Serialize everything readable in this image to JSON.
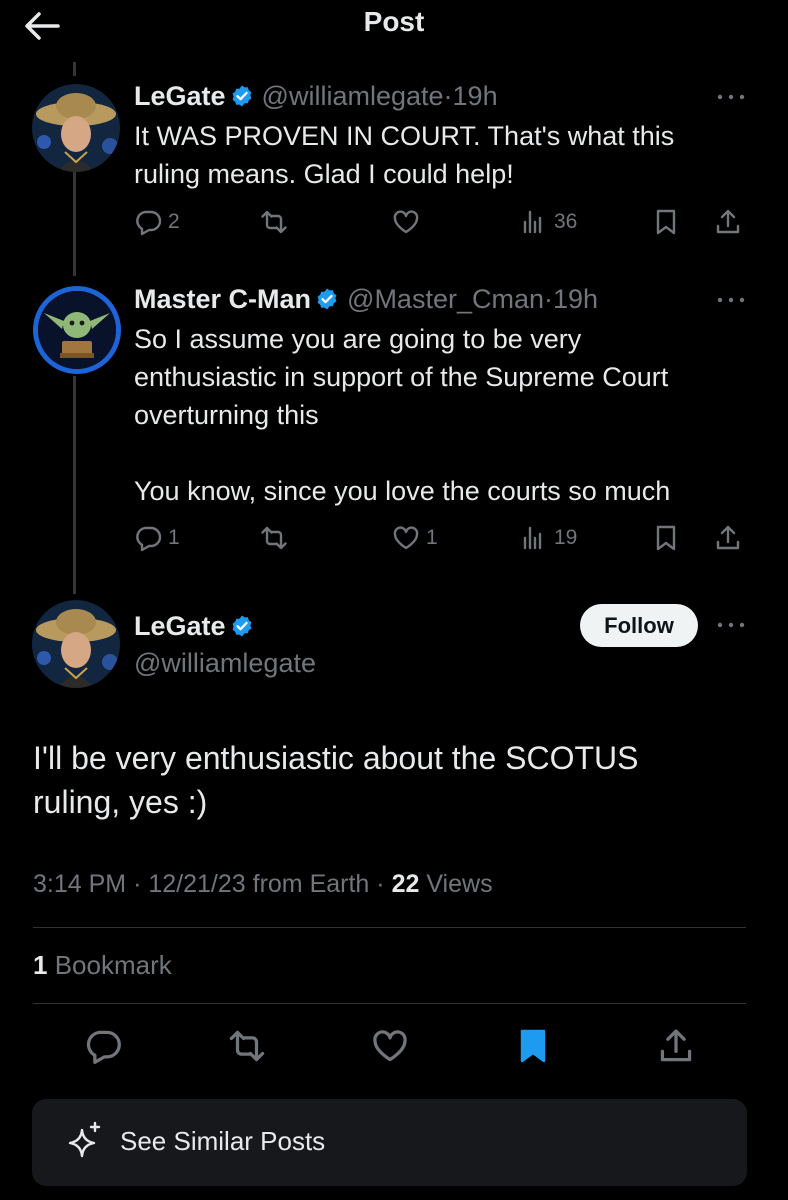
{
  "header": {
    "title": "Post"
  },
  "tweets": [
    {
      "name": "LeGate",
      "handle": "@williamlegate",
      "dot": "·",
      "time": "19h",
      "text": "It WAS PROVEN IN COURT. That's what this\nruling means. Glad I could help!",
      "replies": "2",
      "reposts": "",
      "likes": "",
      "views": "36"
    },
    {
      "name": "Master C-Man",
      "handle": "@Master_Cman",
      "dot": "·",
      "time": "19h",
      "text": "So I assume you are going to be very\nenthusiastic in support of the Supreme Court\noverturning this\n\nYou know, since you love the courts so much",
      "replies": "1",
      "reposts": "",
      "likes": "1",
      "views": "19"
    }
  ],
  "main": {
    "name": "LeGate",
    "handle": "@williamlegate",
    "follow_label": "Follow",
    "text": "I'll be very enthusiastic about the SCOTUS\nruling, yes :)",
    "time": "3:14 PM",
    "sep": "·",
    "date": "12/21/23",
    "source": "from Earth",
    "views_count": "22",
    "views_label": "Views",
    "bookmark_count": "1",
    "bookmark_label": "Bookmark"
  },
  "similar": {
    "label": "See Similar Posts"
  },
  "colors": {
    "background": "#000000",
    "primary_text": "#e7e9ea",
    "secondary_text": "#71767b",
    "accent": "#1d9bf0",
    "verified": "#1d9bf0"
  },
  "icons": [
    "back-arrow-icon",
    "verified-badge-icon",
    "more-icon",
    "reply-icon",
    "repost-icon",
    "like-icon",
    "views-icon",
    "bookmark-icon",
    "share-icon",
    "sparkle-icon"
  ]
}
